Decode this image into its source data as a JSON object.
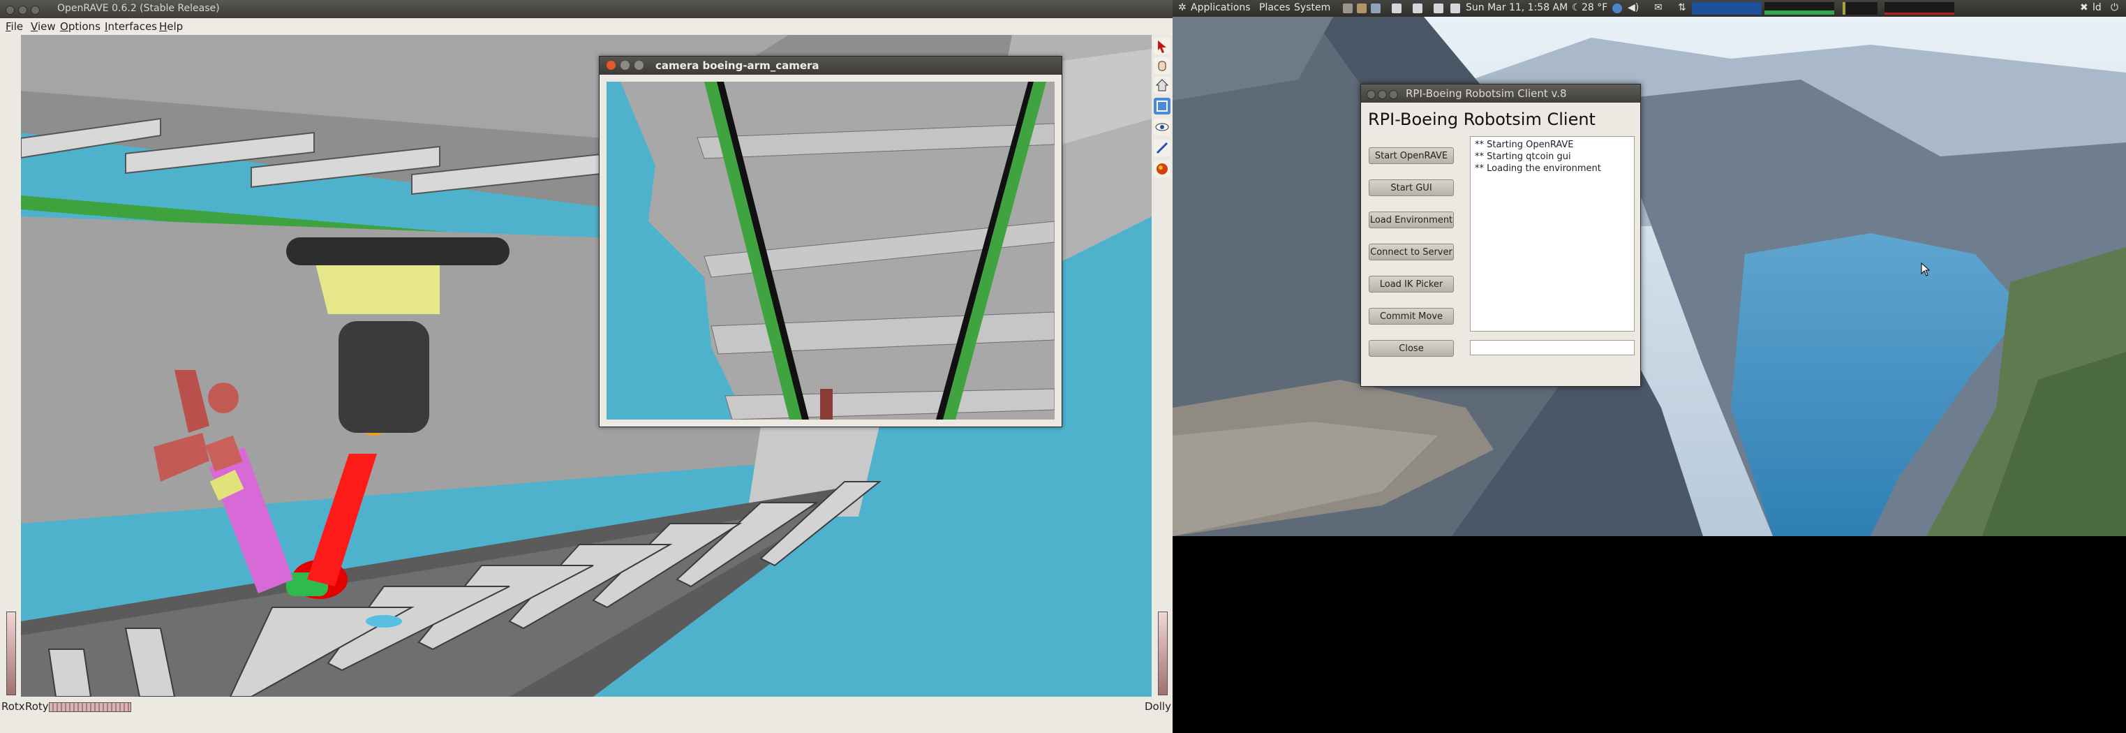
{
  "openrave": {
    "window_title": "OpenRAVE 0.6.2 (Stable Release)",
    "menu": [
      "File",
      "View",
      "Options",
      "Interfaces",
      "Help"
    ],
    "status_left_1": "Rotx",
    "status_left_2": "Roty",
    "status_right": "Dolly",
    "toolbar_icons": [
      "select-arrow-icon",
      "hand-pan-icon",
      "home-icon",
      "view-all-icon",
      "eye-icon",
      "pointer-icon",
      "object-icon"
    ]
  },
  "camera_window": {
    "title": "camera boeing-arm_camera"
  },
  "panel": {
    "applications": "Applications",
    "places": "Places",
    "system": "System",
    "datetime": "Sun Mar 11,  1:58 AM",
    "weather": "28 °F",
    "user": "ld"
  },
  "client": {
    "window_title": "RPI-Boeing Robotsim Client v.8",
    "heading": "RPI-Boeing Robotsim Client",
    "buttons": [
      "Start OpenRAVE",
      "Start GUI",
      "Load Environment",
      "Connect to Server",
      "Load IK Picker",
      "Commit Move",
      "Close"
    ],
    "log": [
      "** Starting OpenRAVE",
      "** Starting qtcoin gui",
      "** Loading the environment"
    ],
    "input_value": ""
  },
  "colors": {
    "sky_blue": "#4eb2cd",
    "fuselage_gray": "#9b9b9b",
    "arm_red": "#ff0000",
    "arm_yellow": "#e8e88a",
    "stringer_green": "#3ea33e"
  }
}
